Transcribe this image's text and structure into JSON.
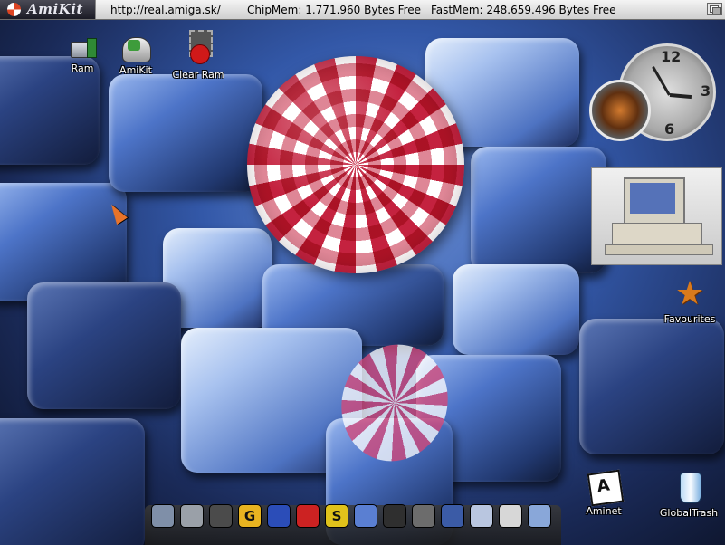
{
  "titlebar": {
    "logo_text": "AmiKit",
    "url": "http://real.amiga.sk/",
    "chipmem": "ChipMem: 1.771.960 Bytes Free",
    "fastmem": "FastMem: 248.659.496 Bytes Free"
  },
  "desktop_icons": {
    "ram": "Ram",
    "amikit": "AmiKit",
    "clear_ram": "Clear Ram",
    "favourites": "Favourites",
    "aminet": "Aminet",
    "global_trash": "GlobalTrash"
  },
  "clock": {
    "numerals": [
      "12",
      "3",
      "6"
    ]
  },
  "dock": {
    "items": [
      {
        "name": "portrait-icon",
        "color": "#7f8fa8",
        "glyph": ""
      },
      {
        "name": "drive-icon",
        "color": "#9aa0a8",
        "glyph": ""
      },
      {
        "name": "spy-icon",
        "color": "#4b4b4b",
        "glyph": ""
      },
      {
        "name": "g-icon",
        "color": "#e8b320",
        "glyph": "G"
      },
      {
        "name": "arcade-icon",
        "color": "#2b4db8",
        "glyph": ""
      },
      {
        "name": "invader-icon",
        "color": "#c22",
        "glyph": ""
      },
      {
        "name": "s-icon",
        "color": "#e0c21b",
        "glyph": "S"
      },
      {
        "name": "globe-icon",
        "color": "#5a7fd2",
        "glyph": ""
      },
      {
        "name": "satellite-icon",
        "color": "#2f2f2f",
        "glyph": ""
      },
      {
        "name": "tools-icon",
        "color": "#6c6c6c",
        "glyph": ""
      },
      {
        "name": "window-icon",
        "color": "#3b5ba6",
        "glyph": ""
      },
      {
        "name": "gear-icon",
        "color": "#b9c6e0",
        "glyph": ""
      },
      {
        "name": "sliders-icon",
        "color": "#d7d7d7",
        "glyph": ""
      },
      {
        "name": "monitor-icon",
        "color": "#89a7d9",
        "glyph": ""
      }
    ]
  }
}
